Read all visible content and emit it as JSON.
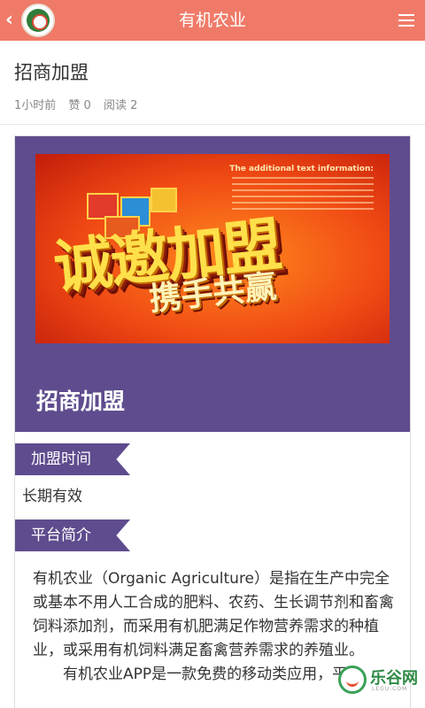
{
  "header": {
    "back_icon": "chevron-left-icon",
    "logo_icon": "organic-farm-logo",
    "title": "有机农业",
    "menu_icon": "hamburger-menu-icon"
  },
  "article": {
    "title": "招商加盟",
    "time": "1小时前",
    "likes": "赞 0",
    "reads": "阅读 2"
  },
  "banner": {
    "eng_title": "The additional text information:",
    "main_text": "诚邀加盟",
    "sub_text": "携手共赢"
  },
  "card": {
    "heading": "招商加盟"
  },
  "sections": [
    {
      "tag": "加盟时间",
      "value": "长期有效"
    },
    {
      "tag": "平台简介"
    }
  ],
  "intro": {
    "paragraph1": "有机农业（Organic Agriculture）是指在生产中完全或基本不用人工合成的肥料、农药、生长调节剂和畜禽饲料添加剂，而采用有机肥满足作物营养需求的种植业，或采用有机饲料满足畜禽营养需求的养殖业。",
    "paragraph2": "有机农业APP是一款免费的移动类应用，平台"
  },
  "watermark": {
    "text": "乐谷网",
    "sub": "LEGU.COM"
  },
  "colors": {
    "header": "#f07a68",
    "accent_purple": "#5f4c8e"
  }
}
